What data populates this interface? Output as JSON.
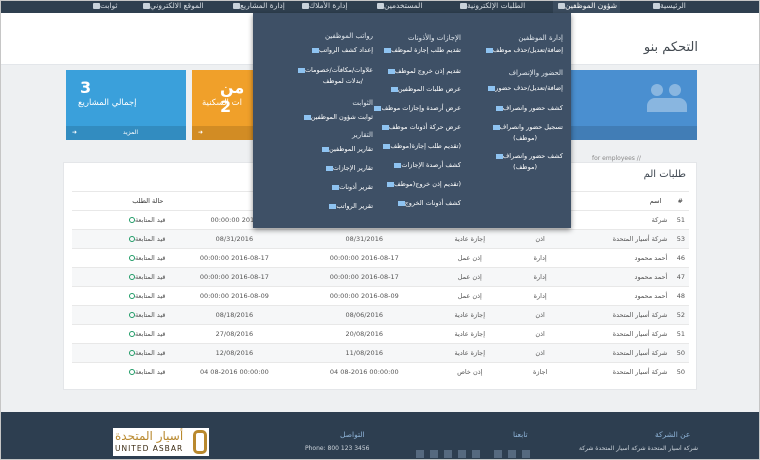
{
  "nav": {
    "home": "الرئيسية",
    "employees_affairs": "شؤون الموظفين",
    "electronic_requests": "الطلبات الإلكترونية",
    "users": "المستخدمين",
    "assets_management": "إدارة الأملاك",
    "projects_management": "إدارة المشاريع",
    "website": "الموقع الالكتروني",
    "settings": "ثوابت"
  },
  "page_title": "التحكم بنو",
  "cards": [
    {
      "value": "من 2",
      "label": "ات السكنية"
    },
    {
      "value": "3",
      "label": "إجمالي المشاريع",
      "footer": "المزيد"
    }
  ],
  "for_employees": "for employees //",
  "panel_title": "طلبات الم",
  "table": {
    "headers": [
      "#",
      "اسم",
      "حالة الطلب"
    ],
    "rows": [
      {
        "num": "51",
        "name": "شركة",
        "type": "",
        "category": "",
        "date1": "",
        "date2": "00:00:00 2016",
        "status": "قيد المتابعة"
      },
      {
        "num": "53",
        "name": "شركة أسيار المتحدة",
        "type": "اذن",
        "category": "إجازة عادية",
        "date1": "08/31/2016",
        "date2": "08/31/2016",
        "status": "قيد المتابعة"
      },
      {
        "num": "46",
        "name": "أحمد محمود",
        "type": "إدارة",
        "category": "إذن عمل",
        "date1": "00:00:00 2016-08-17",
        "date2": "00:00:00 2016-08-17",
        "status": "قيد المتابعة"
      },
      {
        "num": "47",
        "name": "أحمد محمود",
        "type": "إدارة",
        "category": "إذن عمل",
        "date1": "00:00:00 2016-08-17",
        "date2": "00:00:00 2016-08-17",
        "status": "قيد المتابعة"
      },
      {
        "num": "48",
        "name": "أحمد محمود",
        "type": "إدارة",
        "category": "إذن عمل",
        "date1": "00:00:00 2016-08-09",
        "date2": "00:00:00 2016-08-09",
        "status": "قيد المتابعة"
      },
      {
        "num": "52",
        "name": "شركة أسيار المتحدة",
        "type": "اذن",
        "category": "إجازة عادية",
        "date1": "08/06/2016",
        "date2": "08/18/2016",
        "status": "قيد المتابعة"
      },
      {
        "num": "51",
        "name": "شركة أسيار المتحدة",
        "type": "اذن",
        "category": "إجازة عادية",
        "date1": "20/08/2016",
        "date2": "27/08/2016",
        "status": "قيد المتابعة"
      },
      {
        "num": "50",
        "name": "شركة أسيار المتحدة",
        "type": "اذن",
        "category": "إجازة عادية",
        "date1": "11/08/2016",
        "date2": "12/08/2016",
        "status": "قيد المتابعة"
      },
      {
        "num": "50",
        "name": "شركة أسيار المتحدة",
        "type": "اجازة",
        "category": "إذن خاص",
        "date1": "04 08-2016 00:00:00",
        "date2": "04 08-2016 00:00:00",
        "status": "قيد المتابعة"
      }
    ]
  },
  "mega_menu": {
    "col_right": {
      "h1": "إدارة الموظفين",
      "l1": "إضافة/تعديل/حذف موظف",
      "h2": "الحضور والإنصراف",
      "l2": "إضافة/تعديل/حذف حضور",
      "l3": "كشف حضور وانصراف",
      "l4a": "تسجيل حضور وانصراف",
      "l4b": "(موظف)",
      "l5a": "كشف حضور وانصراف",
      "l5b": "(موظف)"
    },
    "col_mid": {
      "h1": "الإجازات والأذونات",
      "l1": "تقديم طلب إجازة لموظف",
      "l2": "تقديم إذن خروج لموظف",
      "l3": "عرض طلبات الموظفين",
      "l4": "عرض أرصدة وإجازات موظف",
      "l5": "عرض حركة أذونات موظف",
      "l6": "(تقديم طلب إجازة(موظف",
      "l7": "كشف أرصدة الإجازات",
      "l8": "(تقديم إذن خروج(موظف",
      "l9": "كشف أذونات الخروج"
    },
    "col_left": {
      "h1": "رواتب الموظفين",
      "l1": "إعداد كشف الرواتب",
      "l2a": "علاوات/مكافآت/خصومات",
      "l2b": "/بدلات لموظف",
      "h2": "الثوابت",
      "l3": "ثوابت شؤون الموظفين",
      "h3": "التقارير",
      "l4": "تقارير الموظفين",
      "l5": "تقارير الإجازات",
      "l6": "تقرير أذونات",
      "l7": "تقرير الرواتب"
    }
  },
  "footer": {
    "about_title": "عن الشركة",
    "about_text": "شركة أسيار المتحدة شركة أسيار المتحدة شركة أسيار",
    "follow_title": "تابعنا",
    "contact_title": "التواصل",
    "phone": "Phone: 800 123 3456",
    "logo_ar": "أسيار المتحدة",
    "logo_en": "UNITED ASBAR"
  },
  "colors": {
    "nav": "#2f3f4f",
    "menu": "#3e5066",
    "card_teal": "#3aa0db",
    "card_orange": "#f0a02a",
    "card_blue": "#4a8fd0",
    "footer": "#2d3e50"
  }
}
